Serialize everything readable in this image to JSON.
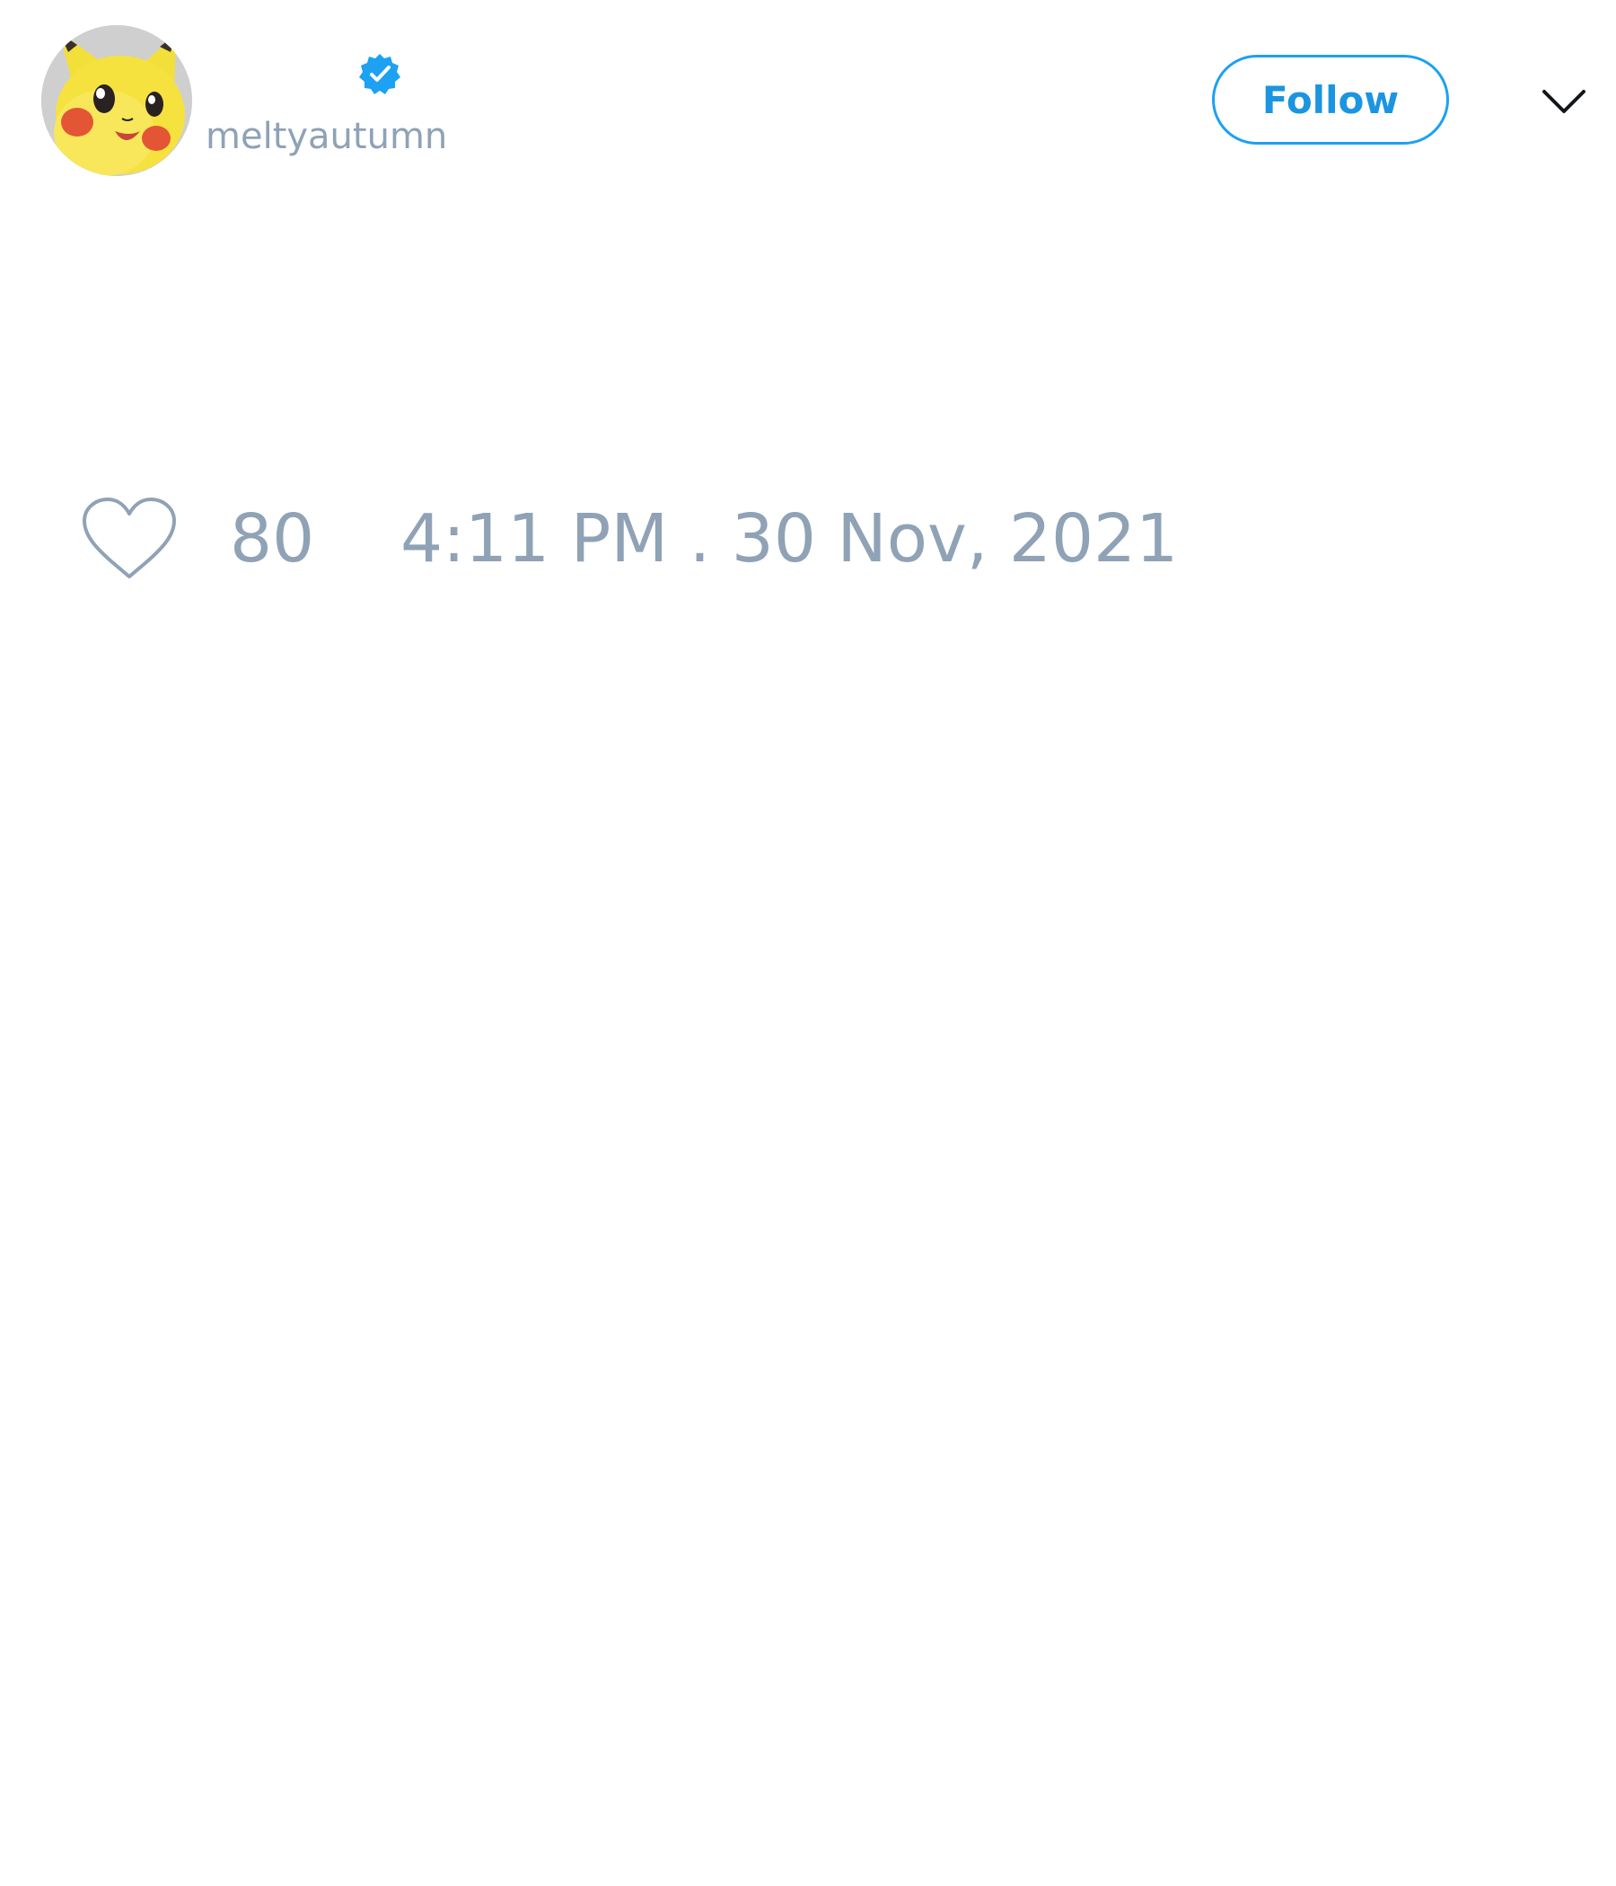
{
  "tweet": {
    "author": {
      "display_name": "",
      "handle": "meltyautumn",
      "verified": true,
      "avatar_icon": "pikachu-avatar"
    },
    "follow_label": "Follow",
    "menu_icon": "chevron-down-icon",
    "likes": {
      "icon": "heart-outline-icon",
      "count": "80"
    },
    "timestamp": "4:11 PM . 30 Nov, 2021"
  },
  "colors": {
    "accent": "#1da1f2",
    "muted_text": "#8fa2b6",
    "background": "#ffffff"
  }
}
